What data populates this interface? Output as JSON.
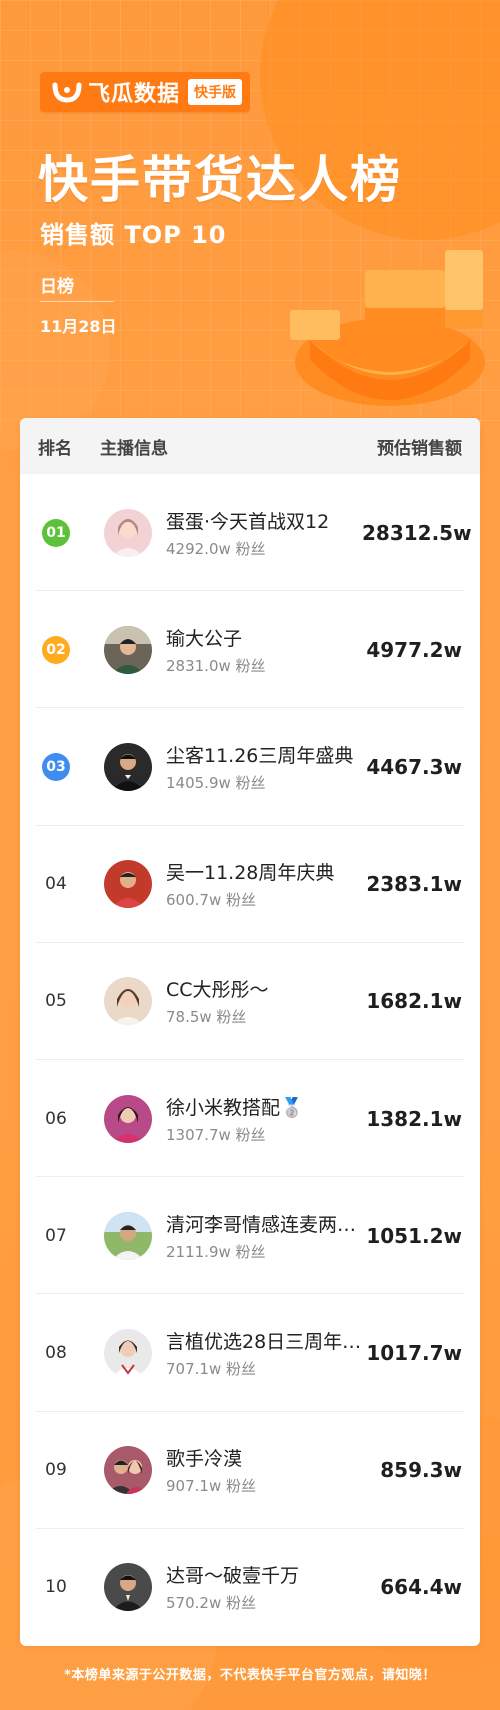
{
  "brand": {
    "name": "飞瓜数据",
    "tag": "快手版"
  },
  "title": "快手带货达人榜",
  "subtitle": "销售额 TOP 10",
  "period": "日榜",
  "date": "11月28日",
  "colors": {
    "brand_orange": "#ff7a12",
    "background": "#ff9d3a",
    "rank1": "#5cc23a",
    "rank2": "#ffab1f",
    "rank3": "#3f8cf0"
  },
  "table": {
    "headers": {
      "rank": "排名",
      "info": "主播信息",
      "sales": "预估销售额"
    },
    "rows": [
      {
        "rank": "01",
        "name": "蛋蛋·今天首战双12",
        "fans": "4292.0w 粉丝",
        "sales": "28312.5w"
      },
      {
        "rank": "02",
        "name": "瑜大公子",
        "fans": "2831.0w 粉丝",
        "sales": "4977.2w"
      },
      {
        "rank": "03",
        "name": "尘客11.26三周年盛典",
        "fans": "1405.9w 粉丝",
        "sales": "4467.3w"
      },
      {
        "rank": "04",
        "name": "吴一11.28周年庆典",
        "fans": "600.7w 粉丝",
        "sales": "2383.1w"
      },
      {
        "rank": "05",
        "name": "CC大彤彤～",
        "fans": "78.5w 粉丝",
        "sales": "1682.1w"
      },
      {
        "rank": "06",
        "name": "徐小米教搭配🥈",
        "fans": "1307.7w 粉丝",
        "sales": "1382.1w"
      },
      {
        "rank": "07",
        "name": "清河李哥情感连麦两…",
        "fans": "2111.9w 粉丝",
        "sales": "1051.2w"
      },
      {
        "rank": "08",
        "name": "言植优选28日三周年…",
        "fans": "707.1w 粉丝",
        "sales": "1017.7w"
      },
      {
        "rank": "09",
        "name": "歌手冷漠",
        "fans": "907.1w 粉丝",
        "sales": "859.3w"
      },
      {
        "rank": "10",
        "name": "达哥～破壹千万",
        "fans": "570.2w 粉丝",
        "sales": "664.4w"
      }
    ]
  },
  "footer": "*本榜单来源于公开数据，不代表快手平台官方观点，请知晓！"
}
